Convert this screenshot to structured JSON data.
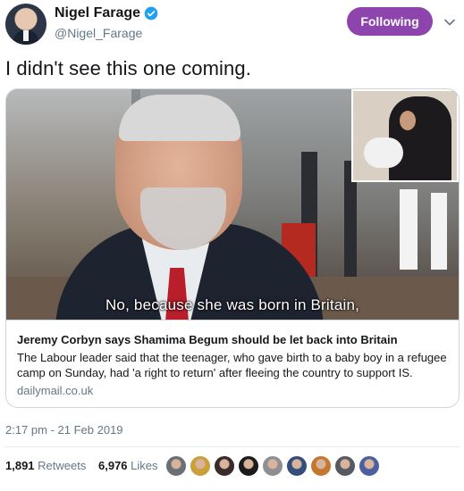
{
  "user": {
    "display_name": "Nigel Farage",
    "handle": "@Nigel_Farage",
    "verified_icon": "verified-badge-icon"
  },
  "actions": {
    "follow_label": "Following",
    "follow_color": "#8e44ad",
    "more_icon": "chevron-down-icon"
  },
  "tweet": {
    "text": "I didn't see this one coming."
  },
  "card": {
    "subtitle": "No, because she was born in Britain,",
    "title": "Jeremy Corbyn says Shamima Begum should be let back into Britain",
    "description": "The Labour leader said that the teenager, who gave birth to a baby boy in a refugee camp on Sunday, had 'a right to return' after fleeing the country to support IS.",
    "domain": "dailymail.co.uk"
  },
  "meta": {
    "timestamp": "2:17 pm - 21 Feb 2019"
  },
  "stats": {
    "retweets_count": "1,891",
    "retweets_label": "Retweets",
    "likes_count": "6,976",
    "likes_label": "Likes"
  },
  "likers": {
    "colors": [
      "#6b6f76",
      "#c9a03a",
      "#3a2a2a",
      "#1b1b1b",
      "#8d8f94",
      "#334e7a",
      "#c4782f",
      "#555a60",
      "#4c5fa0"
    ]
  }
}
